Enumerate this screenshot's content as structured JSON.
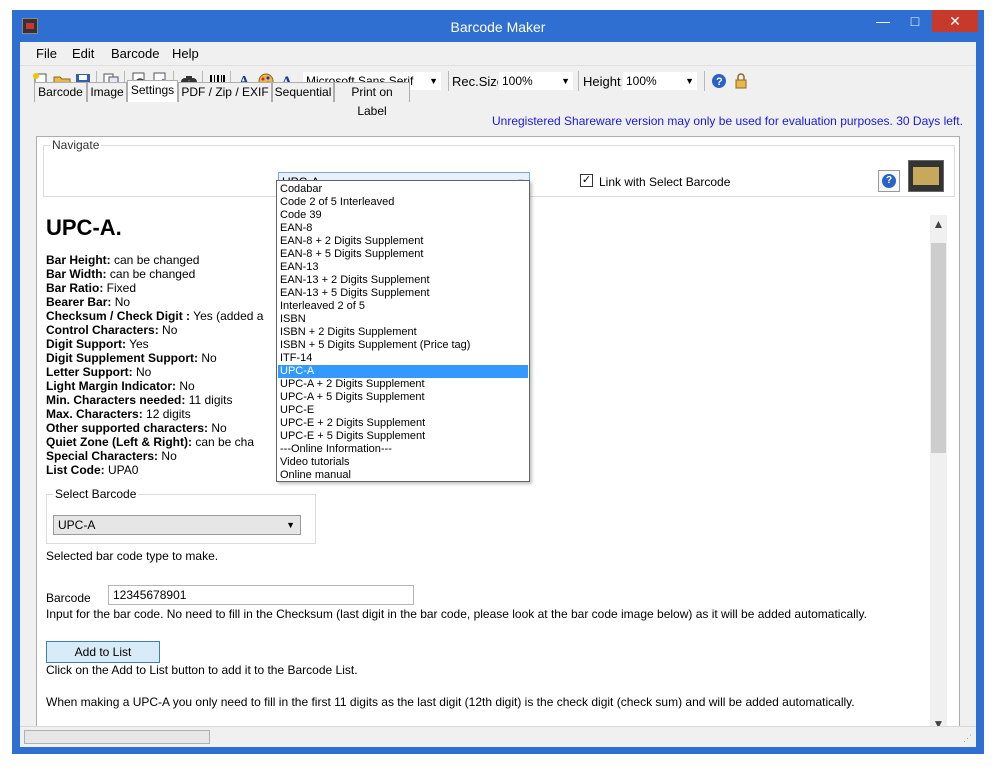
{
  "window": {
    "title": "Barcode Maker",
    "min": "—",
    "max": "□",
    "close": "✕"
  },
  "menu": [
    "File",
    "Edit",
    "Barcode",
    "Help"
  ],
  "toolbar": {
    "font_name": "Microsoft Sans Serif",
    "rec_size_label": "Rec.Size",
    "rec_size_value": "100%",
    "height_label": "Height:",
    "height_value": "100%"
  },
  "tabs": [
    "Barcode",
    "Image",
    "Settings",
    "PDF / Zip / EXIF",
    "Sequential",
    "Print on Label"
  ],
  "active_tab": "Settings",
  "shareware_notice": "Unregistered Shareware version may only be used for evaluation purposes. 30 Days left.",
  "navigate": {
    "label": "Navigate",
    "selected": "UPC-A",
    "link_label": "Link with Select Barcode",
    "link_checked": true
  },
  "heading": "UPC-A.",
  "properties": [
    {
      "label": "Bar Height:",
      "value": " can be changed"
    },
    {
      "label": "Bar Width:",
      "value": " can be changed"
    },
    {
      "label": "Bar Ratio:",
      "value": " Fixed"
    },
    {
      "label": "Bearer Bar:",
      "value": " No"
    },
    {
      "label": "Checksum / Check Digit :",
      "value": " Yes (added a"
    },
    {
      "label": "Control Characters:",
      "value": " No"
    },
    {
      "label": "Digit Support:",
      "value": " Yes"
    },
    {
      "label": "Digit Supplement Support:",
      "value": " No"
    },
    {
      "label": "Letter Support:",
      "value": " No"
    },
    {
      "label": "Light Margin Indicator:",
      "value": " No"
    },
    {
      "label": "Min. Characters needed:",
      "value": " 11 digits"
    },
    {
      "label": "Max. Characters:",
      "value": " 12 digits"
    },
    {
      "label": "Other supported characters:",
      "value": " No"
    },
    {
      "label": "Quiet Zone (Left & Right):",
      "value": " can be cha"
    },
    {
      "label": "Special Characters:",
      "value": " No"
    },
    {
      "label": "List Code:",
      "value": " UPA0"
    }
  ],
  "select_barcode": {
    "label": "Select Barcode",
    "value": "UPC-A",
    "hint": "Selected bar code type to make."
  },
  "barcode": {
    "label": "Barcode",
    "value": "12345678901",
    "hint": "Input for the bar code. No need to fill in the Checksum (last digit in the bar code, please look at the bar code image below) as it will be added automatically."
  },
  "add_button": {
    "label": "Add to List",
    "hint": "Click on the Add to List button to add it to the Barcode List."
  },
  "note": "When making a UPC-A you only need to fill in the first 11 digits as the last digit (12th digit) is the check digit (check sum) and will be added automatically.",
  "dropdown_items": [
    "Codabar",
    "Code 2 of 5 Interleaved",
    "Code 39",
    "EAN-8",
    " EAN-8 + 2 Digits Supplement",
    " EAN-8 + 5 Digits Supplement",
    "EAN-13",
    " EAN-13 + 2 Digits Supplement",
    " EAN-13 + 5 Digits Supplement",
    "Interleaved 2 of 5",
    "ISBN",
    " ISBN + 2 Digits Supplement",
    " ISBN + 5 Digits Supplement (Price tag)",
    "ITF-14",
    "UPC-A",
    " UPC-A + 2 Digits Supplement",
    " UPC-A + 5 Digits Supplement",
    "UPC-E",
    " UPC-E + 2 Digits Supplement",
    " UPC-E + 5 Digits Supplement",
    "---Online Information---",
    "Video tutorials",
    "Online manual"
  ],
  "dropdown_selected_index": 14
}
